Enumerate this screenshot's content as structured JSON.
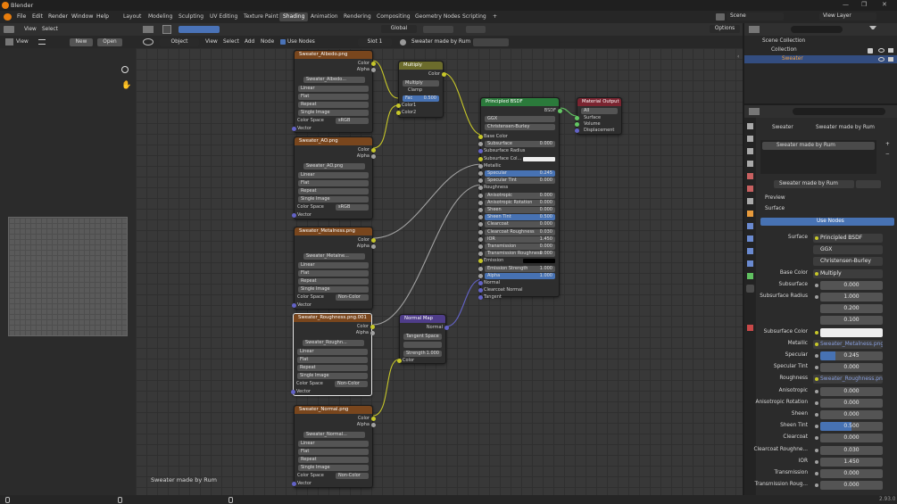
{
  "window": {
    "title": "Blender",
    "controls": [
      "—",
      "❐",
      "✕"
    ]
  },
  "menu": [
    "File",
    "Edit",
    "Render",
    "Window",
    "Help"
  ],
  "workspaces": [
    "Layout",
    "Modeling",
    "Sculpting",
    "UV Editing",
    "Texture Paint",
    "Shading",
    "Animation",
    "Rendering",
    "Compositing",
    "Geometry Nodes",
    "Scripting"
  ],
  "active_workspace": "Shading",
  "scene": {
    "label": "Scene",
    "view_layer": "View Layer"
  },
  "image_editor": {
    "view": "View",
    "new": "New",
    "open": "Open"
  },
  "node_editor": {
    "top": {
      "orientation": "Global",
      "object_mode": "Object",
      "view": "View",
      "select": "Select",
      "add": "Add",
      "node": "Node",
      "use_nodes": "Use Nodes",
      "slot": "Slot 1",
      "material": "Sweater made by Rum",
      "options": "Options"
    },
    "left_header": {
      "view": "View",
      "select": "Select"
    },
    "footer_label": "Sweater made by Rum",
    "textures": [
      {
        "title": "Sweater_Albedo.png",
        "image": "Sweater_Albedo...",
        "color_space": "sRGB"
      },
      {
        "title": "Sweater_AO.png",
        "image": "Sweater_AO.png",
        "color_space": "sRGB"
      },
      {
        "title": "Sweater_Metalness.png",
        "image": "Sweater_Metalne...",
        "color_space": "Non-Color"
      },
      {
        "title": "Sweater_Roughness.png.001",
        "image": "Sweater_Roughn...",
        "color_space": "Non-Color"
      },
      {
        "title": "Sweater_Normal.png",
        "image": "Sweater_Normal...",
        "color_space": "Non-Color"
      }
    ],
    "tex_rows": {
      "color": "Color",
      "alpha": "Alpha",
      "interp": "Linear",
      "proj": "Flat",
      "ext": "Repeat",
      "single": "Single Image",
      "cs": "Color Space",
      "vector": "Vector"
    },
    "multiply": {
      "title": "Multiply",
      "color": "Color",
      "mode": "Multiply",
      "clamp": "Clamp",
      "fac": "Fac",
      "fac_val": "0.500",
      "c1": "Color1",
      "c2": "Color2"
    },
    "normal_map": {
      "title": "Normal Map",
      "normal": "Normal",
      "space": "Tangent Space",
      "strength": "Strength",
      "strength_val": "1.000",
      "color": "Color"
    },
    "bsdf": {
      "title": "Principled BSDF",
      "bsdf": "BSDF",
      "dist": "GGX",
      "sss": "Christensen-Burley",
      "rows": [
        {
          "n": "Base Color",
          "v": ""
        },
        {
          "n": "Subsurface",
          "v": "0.000"
        },
        {
          "n": "Subsurface Radius",
          "v": ""
        },
        {
          "n": "Subsurface Col...",
          "v": ""
        },
        {
          "n": "Metallic",
          "v": ""
        },
        {
          "n": "Specular",
          "v": "0.245"
        },
        {
          "n": "Specular Tint",
          "v": "0.000"
        },
        {
          "n": "Roughness",
          "v": ""
        },
        {
          "n": "Anisotropic",
          "v": "0.000"
        },
        {
          "n": "Anisotropic Rotation",
          "v": "0.000"
        },
        {
          "n": "Sheen",
          "v": "0.000"
        },
        {
          "n": "Sheen Tint",
          "v": "0.500"
        },
        {
          "n": "Clearcoat",
          "v": "0.000"
        },
        {
          "n": "Clearcoat Roughness",
          "v": "0.030"
        },
        {
          "n": "IOR",
          "v": "1.450"
        },
        {
          "n": "Transmission",
          "v": "0.000"
        },
        {
          "n": "Transmission Roughness",
          "v": "0.000"
        },
        {
          "n": "Emission",
          "v": ""
        },
        {
          "n": "Emission Strength",
          "v": "1.000"
        },
        {
          "n": "Alpha",
          "v": "1.000"
        },
        {
          "n": "Normal",
          "v": ""
        },
        {
          "n": "Clearcoat Normal",
          "v": ""
        },
        {
          "n": "Tangent",
          "v": ""
        }
      ]
    },
    "output": {
      "title": "Material Output",
      "target": "All",
      "surface": "Surface",
      "volume": "Volume",
      "displacement": "Displacement"
    }
  },
  "outliner": {
    "scene_collection": "Scene Collection",
    "collection": "Collection",
    "object": "Sweater"
  },
  "properties": {
    "object": "Sweater",
    "material": "Sweater made by Rum",
    "slot_material": "Sweater made by Rum",
    "preview": "Preview",
    "surface_section": "Surface",
    "use_nodes": "Use Nodes",
    "rows": [
      {
        "label": "Surface",
        "value": "Principled BSDF"
      },
      {
        "label": "",
        "value": "GGX"
      },
      {
        "label": "",
        "value": "Christensen-Burley"
      },
      {
        "label": "Base Color",
        "value": "Multiply"
      },
      {
        "label": "Subsurface",
        "value": "0.000"
      },
      {
        "label": "Subsurface Radius",
        "value": "1.000"
      },
      {
        "label": "",
        "value": "0.200"
      },
      {
        "label": "",
        "value": "0.100"
      },
      {
        "label": "Subsurface Color",
        "value": ""
      },
      {
        "label": "Metallic",
        "value": "Sweater_Metalness.png"
      },
      {
        "label": "Specular",
        "value": "0.245"
      },
      {
        "label": "Specular Tint",
        "value": "0.000"
      },
      {
        "label": "Roughness",
        "value": "Sweater_Roughness.png..."
      },
      {
        "label": "Anisotropic",
        "value": "0.000"
      },
      {
        "label": "Anisotropic Rotation",
        "value": "0.000"
      },
      {
        "label": "Sheen",
        "value": "0.000"
      },
      {
        "label": "Sheen Tint",
        "value": "0.500"
      },
      {
        "label": "Clearcoat",
        "value": "0.000"
      },
      {
        "label": "Clearcoat Roughne...",
        "value": "0.030"
      },
      {
        "label": "IOR",
        "value": "1.450"
      },
      {
        "label": "Transmission",
        "value": "0.000"
      },
      {
        "label": "Transmission Roug...",
        "value": "0.000"
      }
    ]
  },
  "status": {
    "version": "2.93.0"
  }
}
